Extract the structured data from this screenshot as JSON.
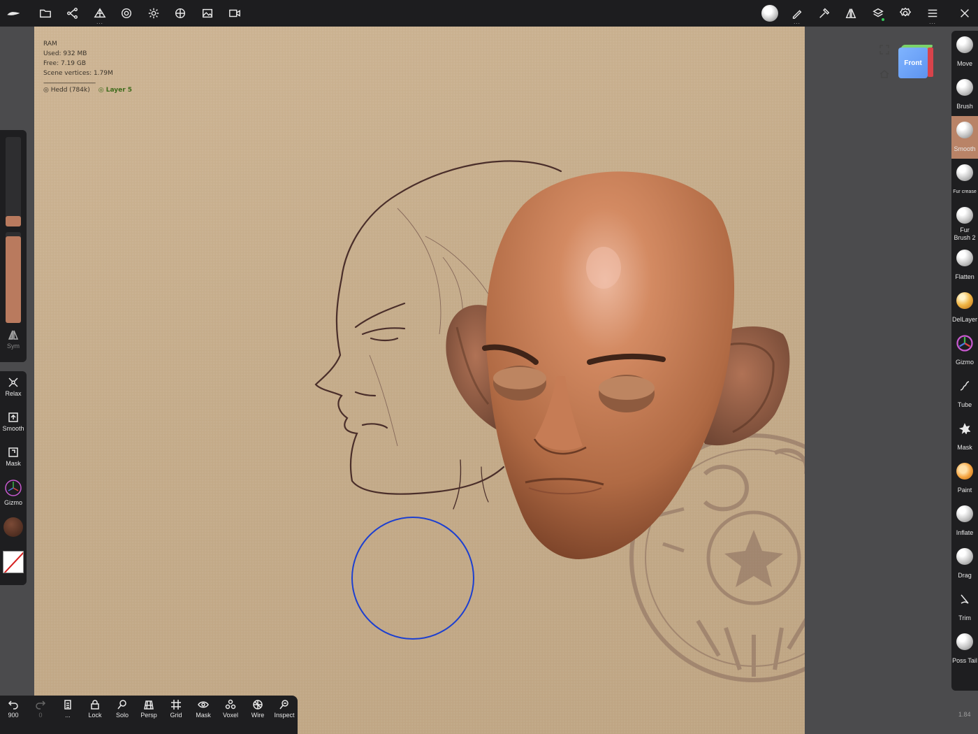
{
  "top_toolbar": {
    "left_icons": [
      "nomad-logo-icon",
      "folder-icon",
      "scene-graph-icon",
      "topology-icon",
      "material-icon",
      "lighting-icon",
      "postprocess-icon",
      "background-icon",
      "video-icon"
    ],
    "right_icons": [
      "brush-preview-icon",
      "stroke-icon",
      "painting-icon",
      "symmetry-icon",
      "layers-icon",
      "settings-icon",
      "interface-icon",
      "close-icon"
    ]
  },
  "info_overlay": {
    "ram_label": "RAM",
    "used": "Used:  932 MB",
    "free": "Free:  7.19 GB",
    "scene_vertices": "Scene vertices:  1.79M",
    "separator": "---------------------------------",
    "mesh_name": "Hedd (784k)",
    "layer_name": "Layer 5",
    "colors": {
      "layer": "#3f6b1c"
    }
  },
  "nav_cube": {
    "face_label": "Front"
  },
  "left_panel": {
    "radius_level": 0.12,
    "intensity_level": 0.95,
    "sym_label": "Sym",
    "tools": [
      {
        "name": "relax",
        "label": "Relax"
      },
      {
        "name": "smooth",
        "label": "Smooth"
      },
      {
        "name": "mask",
        "label": "Mask"
      },
      {
        "name": "gizmo",
        "label": "Gizmo"
      }
    ],
    "accent": "#b97a5e"
  },
  "right_tools": [
    {
      "label": "Move",
      "active": false
    },
    {
      "label": "Brush",
      "active": false
    },
    {
      "label": "Smooth",
      "active": true
    },
    {
      "label": "Fur crease",
      "active": false
    },
    {
      "label": "Fur Brush 2",
      "active": false
    },
    {
      "label": "Flatten",
      "active": false
    },
    {
      "label": "DelLayer",
      "active": false
    },
    {
      "label": "Gizmo",
      "active": false
    },
    {
      "label": "Tube",
      "active": false
    },
    {
      "label": "Mask",
      "active": false
    },
    {
      "label": "Paint",
      "active": false
    },
    {
      "label": "Inflate",
      "active": false
    },
    {
      "label": "Drag",
      "active": false
    },
    {
      "label": "Trim",
      "active": false
    },
    {
      "label": "Poss Tail",
      "active": false
    }
  ],
  "bottom_bar": {
    "undo_count": "900",
    "redo_count": "0",
    "buttons": [
      {
        "name": "wireframe",
        "label": "..."
      },
      {
        "name": "lock",
        "label": "Lock"
      },
      {
        "name": "solo",
        "label": "Solo"
      },
      {
        "name": "persp",
        "label": "Persp"
      },
      {
        "name": "grid",
        "label": "Grid"
      },
      {
        "name": "mask",
        "label": "Mask"
      },
      {
        "name": "voxel",
        "label": "Voxel"
      },
      {
        "name": "wire",
        "label": "Wire"
      },
      {
        "name": "inspect",
        "label": "Inspect"
      }
    ]
  },
  "version_label": "1.84",
  "brush_cursor_color": "#1c3fd0"
}
